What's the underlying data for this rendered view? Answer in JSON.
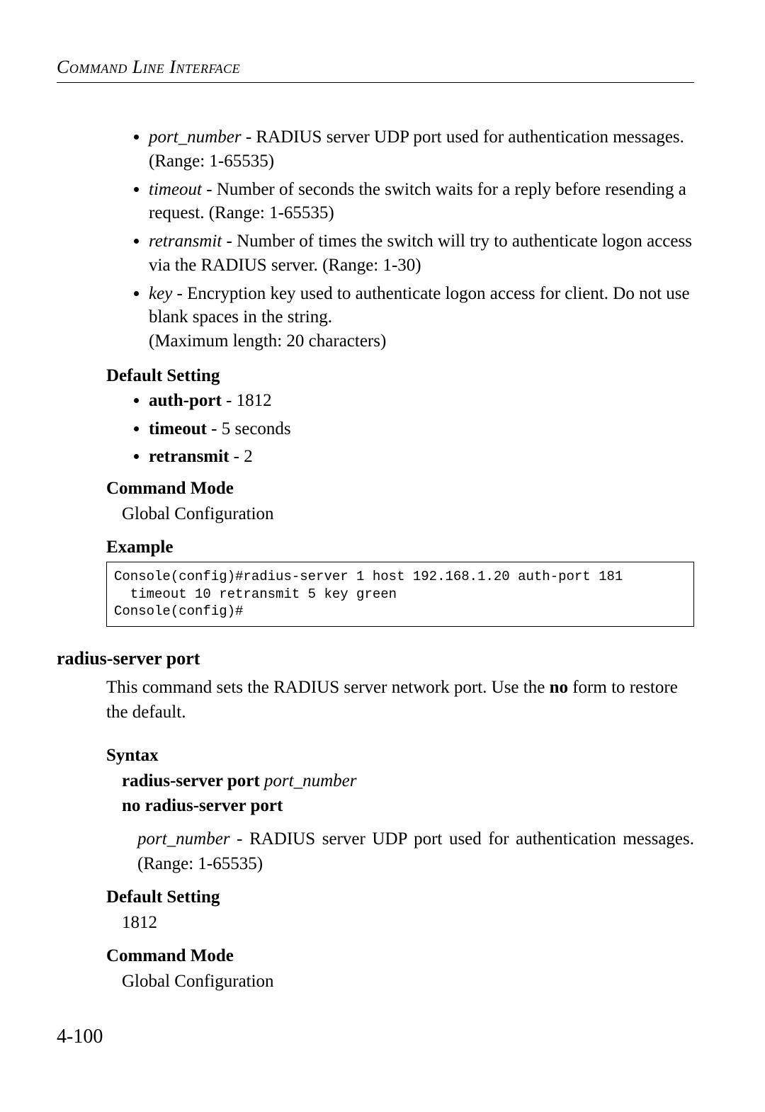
{
  "running_head": "Command Line Interface",
  "params": [
    {
      "name": "port_number",
      "desc": " - RADIUS server UDP port used for authentication messages. (Range: 1-65535)"
    },
    {
      "name": "timeout",
      "desc": " - Number of seconds the switch waits for a reply before resending a request. (Range: 1-65535)"
    },
    {
      "name": "retransmit",
      "desc": " - Number of times the switch will try to authenticate logon access via the RADIUS server. (Range: 1-30)"
    },
    {
      "name": "key",
      "desc": " - Encryption key used to authenticate logon access for client. Do not use blank spaces in the string.\n(Maximum length: 20 characters)"
    }
  ],
  "labels": {
    "default_setting": "Default Setting",
    "command_mode": "Command Mode",
    "example": "Example",
    "syntax": "Syntax"
  },
  "defaults": [
    {
      "name": "auth-port",
      "value": " - 1812"
    },
    {
      "name": "timeout",
      "value": " - 5 seconds"
    },
    {
      "name": "retransmit",
      "value": " - 2"
    }
  ],
  "command_mode_value": "Global Configuration",
  "example_code": "Console(config)#radius-server 1 host 192.168.1.20 auth-port 181 \n  timeout 10 retransmit 5 key green\nConsole(config)#",
  "section2": {
    "title": "radius-server port",
    "desc_pre": "This command sets the RADIUS server network port. Use the ",
    "desc_bold": "no",
    "desc_post": " form to restore the default.",
    "syntax_line1_bold": "radius-server port",
    "syntax_line1_italic": " port_number",
    "syntax_line2": "no radius-server port",
    "arg_name": "port_number",
    "arg_desc": " - RADIUS server UDP port used for authentication messages. (Range: 1-65535)",
    "default_value": "1812",
    "command_mode_value": "Global Configuration"
  },
  "page_number": "4-100"
}
